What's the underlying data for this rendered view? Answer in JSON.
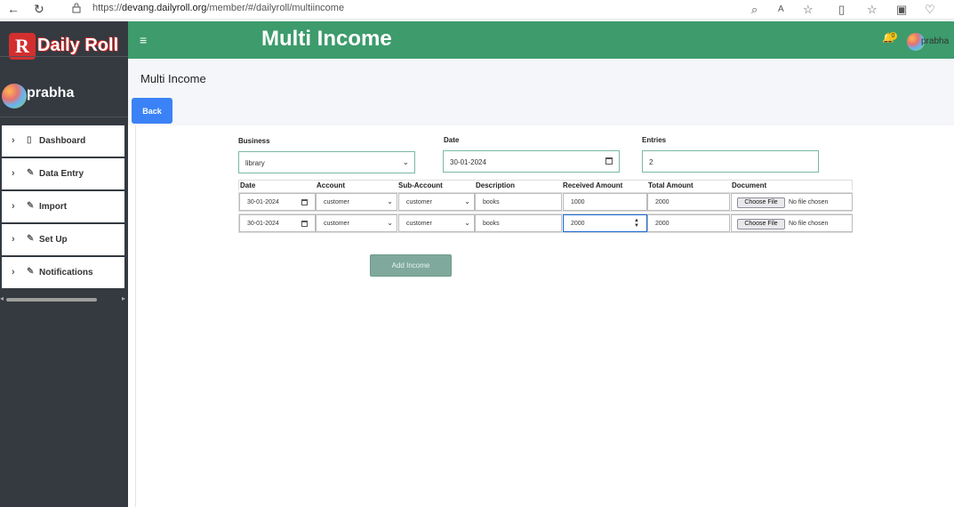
{
  "browser": {
    "url_scheme": "https://",
    "url_host": "devang.dailyroll.org",
    "url_path": "/member/#/dailyroll/multiincome"
  },
  "sidebar": {
    "logo_letter": "R",
    "logo_text": "Daily Roll",
    "user_name": "prabha",
    "items": [
      {
        "label": "Dashboard",
        "icon": "file-icon"
      },
      {
        "label": "Data Entry",
        "icon": "pencil-icon"
      },
      {
        "label": "Import",
        "icon": "pencil-icon"
      },
      {
        "label": "Set Up",
        "icon": "pencil-icon"
      },
      {
        "label": "Notifications",
        "icon": "pencil-icon"
      }
    ]
  },
  "header": {
    "title": "Multi Income",
    "notification_count": "0",
    "user_name": "prabha",
    "accent_color": "#3d9b6c"
  },
  "page": {
    "title": "Multi Income",
    "back_label": "Back"
  },
  "form": {
    "business_label": "Business",
    "business_value": "library",
    "date_label": "Date",
    "date_value": "30-01-2024",
    "entries_label": "Entries",
    "entries_value": "2"
  },
  "grid": {
    "columns": [
      "Date",
      "Account",
      "Sub-Account",
      "Description",
      "Received Amount",
      "Total Amount",
      "Document"
    ],
    "rows": [
      {
        "date": "30-01-2024",
        "account": "customer",
        "sub_account": "customer",
        "description": "books",
        "received": "1000",
        "total": "2000",
        "file_button": "Choose File",
        "file_status": "No file chosen"
      },
      {
        "date": "30-01-2024",
        "account": "customer",
        "sub_account": "customer",
        "description": "books",
        "received": "2000",
        "total": "2000",
        "file_button": "Choose File",
        "file_status": "No file chosen"
      }
    ]
  },
  "actions": {
    "add_label": "Add Income"
  }
}
